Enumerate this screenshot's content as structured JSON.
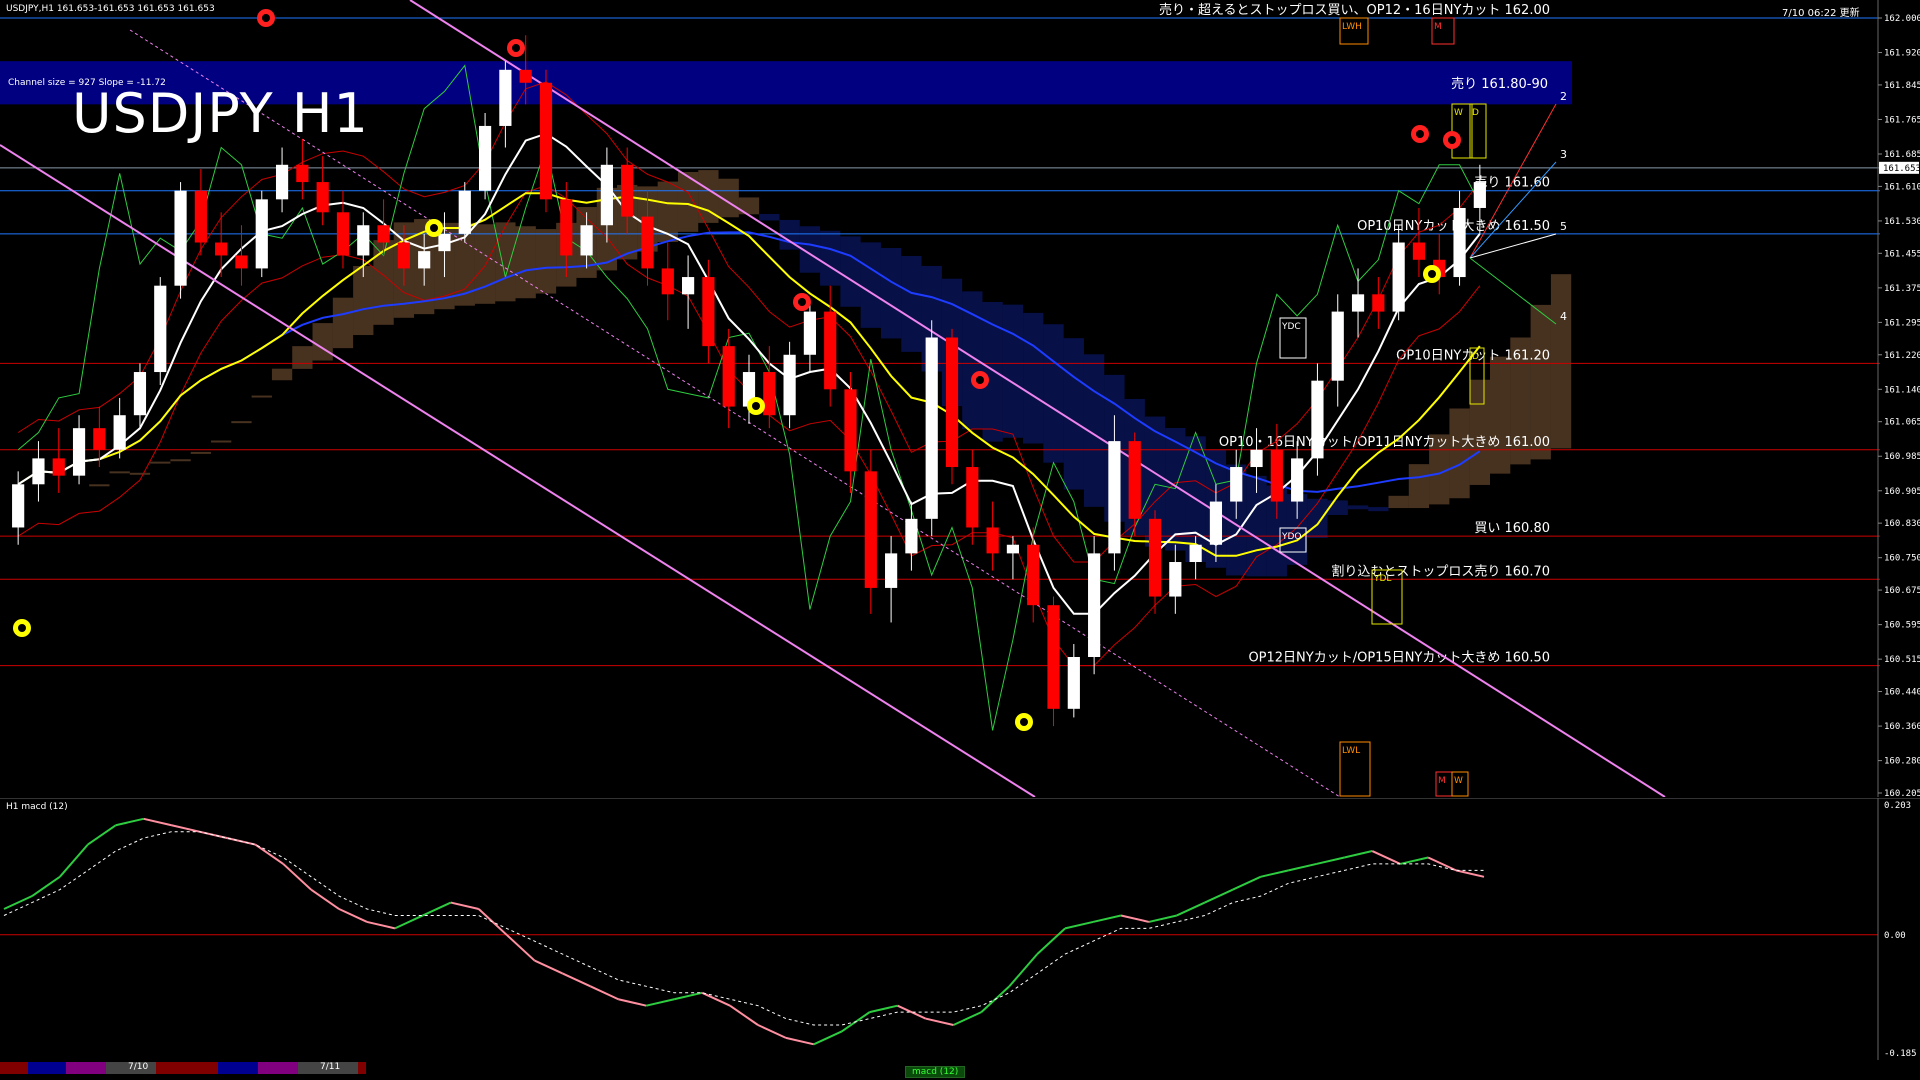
{
  "header": {
    "symbol_info": "USDJPY,H1  161.653-161.653 161.653 161.653",
    "top_right": "7/10 06:22 更新"
  },
  "chart_title": "USDJPY H1",
  "channel_info": "Channel size = 927 Slope = -11.72",
  "macd_label": "H1  macd (12)",
  "colors": {
    "bull": "#ffffff",
    "bear": "#ff0000",
    "ma_short": "#ffffff",
    "ma_mid": "#ffff00",
    "ma_long": "#1e3cff",
    "bollinger": "#cc0000",
    "chikou": "#2ecc40",
    "ichimoku_span": "#e6e600",
    "cloud_blue": "#1a3aff",
    "cloud_orange": "#ffb070",
    "channel": "#ee82ee",
    "level_red": "#cc0000",
    "level_blue": "#1e78ff",
    "macd_up": "#2ecc40",
    "macd_down": "#ff8fa0",
    "macd_signal": "#ffffff"
  },
  "zone": {
    "label": "売り 161.80-90",
    "color": "#000080"
  },
  "levels": [
    {
      "price": 162.0,
      "label": "売り・超えるとストップロス買い、OP12・16日NYカット 162.00",
      "color": "#1e78ff"
    },
    {
      "price": 161.653,
      "label": "",
      "color": "#8899aa"
    },
    {
      "price": 161.6,
      "label": "売り 161.60",
      "color": "#1e78ff"
    },
    {
      "price": 161.5,
      "label": "OP10日NYカット大きめ 161.50",
      "color": "#1e78ff"
    },
    {
      "price": 161.2,
      "label": "OP10日NYカット 161.20",
      "color": "#cc0000"
    },
    {
      "price": 161.0,
      "label": "OP10・16日NYカット/OP11日NYカット大きめ 161.00",
      "color": "#cc0000"
    },
    {
      "price": 160.8,
      "label": "買い 160.80",
      "color": "#cc0000"
    },
    {
      "price": 160.7,
      "label": "割り込むとストップロス売り 160.70",
      "color": "#cc0000"
    },
    {
      "price": 160.5,
      "label": "OP12日NYカット/OP15日NYカット大きめ 160.50",
      "color": "#cc0000"
    }
  ],
  "marker_labels": {
    "lwh": "LWH",
    "m_top": "M",
    "w_top": "W",
    "d_top": "D",
    "ydc": "YDC",
    "ydo": "YDO",
    "ydl": "YDL",
    "lwl": "LWL",
    "m_bot": "M",
    "w_bot": "W",
    "d_mid": "D",
    "fib2": "2",
    "fib3": "3",
    "fib5": "5",
    "fib4": "4"
  },
  "price_axis_ticks": [
    "162.000",
    "161.920",
    "161.845",
    "161.765",
    "161.685",
    "161.610",
    "161.530",
    "161.455",
    "161.375",
    "161.295",
    "161.220",
    "161.140",
    "161.065",
    "160.985",
    "160.905",
    "160.830",
    "160.750",
    "160.675",
    "160.595",
    "160.515",
    "160.440",
    "160.360",
    "160.280",
    "160.205"
  ],
  "current_price": "161.653",
  "macd_axis_ticks": [
    "0.203",
    "0.00",
    "-0.185"
  ],
  "footer": {
    "date1": "7/10",
    "date2": "7/11",
    "tab": "macd (12)"
  },
  "chart_data": [
    {
      "type": "candlestick",
      "title": "USDJPY H1",
      "ylim": [
        160.205,
        162.0
      ],
      "candles": [
        [
          160.82,
          160.95,
          160.78,
          160.92
        ],
        [
          160.92,
          161.02,
          160.88,
          160.98
        ],
        [
          160.98,
          161.05,
          160.9,
          160.94
        ],
        [
          160.94,
          161.08,
          160.92,
          161.05
        ],
        [
          161.05,
          161.1,
          160.96,
          161.0
        ],
        [
          161.0,
          161.12,
          160.98,
          161.08
        ],
        [
          161.08,
          161.2,
          161.05,
          161.18
        ],
        [
          161.18,
          161.4,
          161.15,
          161.38
        ],
        [
          161.38,
          161.62,
          161.35,
          161.6
        ],
        [
          161.6,
          161.65,
          161.45,
          161.48
        ],
        [
          161.48,
          161.55,
          161.4,
          161.45
        ],
        [
          161.45,
          161.52,
          161.38,
          161.42
        ],
        [
          161.42,
          161.6,
          161.4,
          161.58
        ],
        [
          161.58,
          161.7,
          161.55,
          161.66
        ],
        [
          161.66,
          161.72,
          161.58,
          161.62
        ],
        [
          161.62,
          161.68,
          161.52,
          161.55
        ],
        [
          161.55,
          161.6,
          161.42,
          161.45
        ],
        [
          161.45,
          161.55,
          161.4,
          161.52
        ],
        [
          161.52,
          161.58,
          161.45,
          161.48
        ],
        [
          161.48,
          161.52,
          161.38,
          161.42
        ],
        [
          161.42,
          161.5,
          161.38,
          161.46
        ],
        [
          161.46,
          161.55,
          161.4,
          161.5
        ],
        [
          161.5,
          161.62,
          161.48,
          161.6
        ],
        [
          161.6,
          161.78,
          161.58,
          161.75
        ],
        [
          161.75,
          161.9,
          161.7,
          161.88
        ],
        [
          161.88,
          161.96,
          161.8,
          161.85
        ],
        [
          161.85,
          161.88,
          161.55,
          161.58
        ],
        [
          161.58,
          161.62,
          161.4,
          161.45
        ],
        [
          161.45,
          161.55,
          161.42,
          161.52
        ],
        [
          161.52,
          161.7,
          161.48,
          161.66
        ],
        [
          161.66,
          161.7,
          161.5,
          161.54
        ],
        [
          161.54,
          161.6,
          161.38,
          161.42
        ],
        [
          161.42,
          161.48,
          161.3,
          161.36
        ],
        [
          161.36,
          161.45,
          161.28,
          161.4
        ],
        [
          161.4,
          161.44,
          161.2,
          161.24
        ],
        [
          161.24,
          161.28,
          161.05,
          161.1
        ],
        [
          161.1,
          161.22,
          161.06,
          161.18
        ],
        [
          161.18,
          161.24,
          161.05,
          161.08
        ],
        [
          161.08,
          161.25,
          161.05,
          161.22
        ],
        [
          161.22,
          161.35,
          161.18,
          161.32
        ],
        [
          161.32,
          161.38,
          161.1,
          161.14
        ],
        [
          161.14,
          161.18,
          160.9,
          160.95
        ],
        [
          160.95,
          161.0,
          160.62,
          160.68
        ],
        [
          160.68,
          160.8,
          160.6,
          160.76
        ],
        [
          160.76,
          160.88,
          160.72,
          160.84
        ],
        [
          160.84,
          161.3,
          160.8,
          161.26
        ],
        [
          161.26,
          161.28,
          160.92,
          160.96
        ],
        [
          160.96,
          161.0,
          160.78,
          160.82
        ],
        [
          160.82,
          160.88,
          160.72,
          160.76
        ],
        [
          160.76,
          160.8,
          160.7,
          160.78
        ],
        [
          160.78,
          160.82,
          160.6,
          160.64
        ],
        [
          160.64,
          160.66,
          160.36,
          160.4
        ],
        [
          160.4,
          160.55,
          160.38,
          160.52
        ],
        [
          160.52,
          160.8,
          160.48,
          160.76
        ],
        [
          160.76,
          161.08,
          160.72,
          161.02
        ],
        [
          161.02,
          161.04,
          160.8,
          160.84
        ],
        [
          160.84,
          160.86,
          160.62,
          160.66
        ],
        [
          160.66,
          160.78,
          160.62,
          160.74
        ],
        [
          160.74,
          160.8,
          160.7,
          160.78
        ],
        [
          160.78,
          160.92,
          160.74,
          160.88
        ],
        [
          160.88,
          161.0,
          160.84,
          160.96
        ],
        [
          160.96,
          161.05,
          160.9,
          161.0
        ],
        [
          161.0,
          161.06,
          160.84,
          160.88
        ],
        [
          160.88,
          161.02,
          160.84,
          160.98
        ],
        [
          160.98,
          161.2,
          160.94,
          161.16
        ],
        [
          161.16,
          161.36,
          161.1,
          161.32
        ],
        [
          161.32,
          161.42,
          161.26,
          161.36
        ],
        [
          161.36,
          161.4,
          161.28,
          161.32
        ],
        [
          161.32,
          161.52,
          161.3,
          161.48
        ],
        [
          161.48,
          161.56,
          161.4,
          161.44
        ],
        [
          161.44,
          161.5,
          161.36,
          161.4
        ],
        [
          161.4,
          161.6,
          161.38,
          161.56
        ],
        [
          161.56,
          161.66,
          161.5,
          161.62
        ]
      ]
    },
    {
      "type": "line",
      "title": "macd (12)",
      "ylim": [
        -0.185,
        0.203
      ],
      "series": [
        {
          "values": [
            0.04,
            0.06,
            0.09,
            0.14,
            0.17,
            0.18,
            0.17,
            0.16,
            0.15,
            0.14,
            0.11,
            0.07,
            0.04,
            0.02,
            0.01,
            0.03,
            0.05,
            0.04,
            0.0,
            -0.04,
            -0.06,
            -0.08,
            -0.1,
            -0.11,
            -0.1,
            -0.09,
            -0.11,
            -0.14,
            -0.16,
            -0.17,
            -0.15,
            -0.12,
            -0.11,
            -0.13,
            -0.14,
            -0.12,
            -0.08,
            -0.03,
            0.01,
            0.02,
            0.03,
            0.02,
            0.03,
            0.05,
            0.07,
            0.09,
            0.1,
            0.11,
            0.12,
            0.13,
            0.11,
            0.12,
            0.1,
            0.09
          ]
        },
        {
          "values": [
            0.03,
            0.05,
            0.07,
            0.1,
            0.13,
            0.15,
            0.16,
            0.16,
            0.15,
            0.14,
            0.12,
            0.09,
            0.06,
            0.04,
            0.03,
            0.03,
            0.03,
            0.03,
            0.01,
            -0.01,
            -0.03,
            -0.05,
            -0.07,
            -0.08,
            -0.09,
            -0.09,
            -0.1,
            -0.11,
            -0.13,
            -0.14,
            -0.14,
            -0.13,
            -0.12,
            -0.12,
            -0.12,
            -0.11,
            -0.09,
            -0.06,
            -0.03,
            -0.01,
            0.01,
            0.01,
            0.02,
            0.03,
            0.05,
            0.06,
            0.08,
            0.09,
            0.1,
            0.11,
            0.11,
            0.11,
            0.1,
            0.1
          ]
        }
      ]
    }
  ]
}
